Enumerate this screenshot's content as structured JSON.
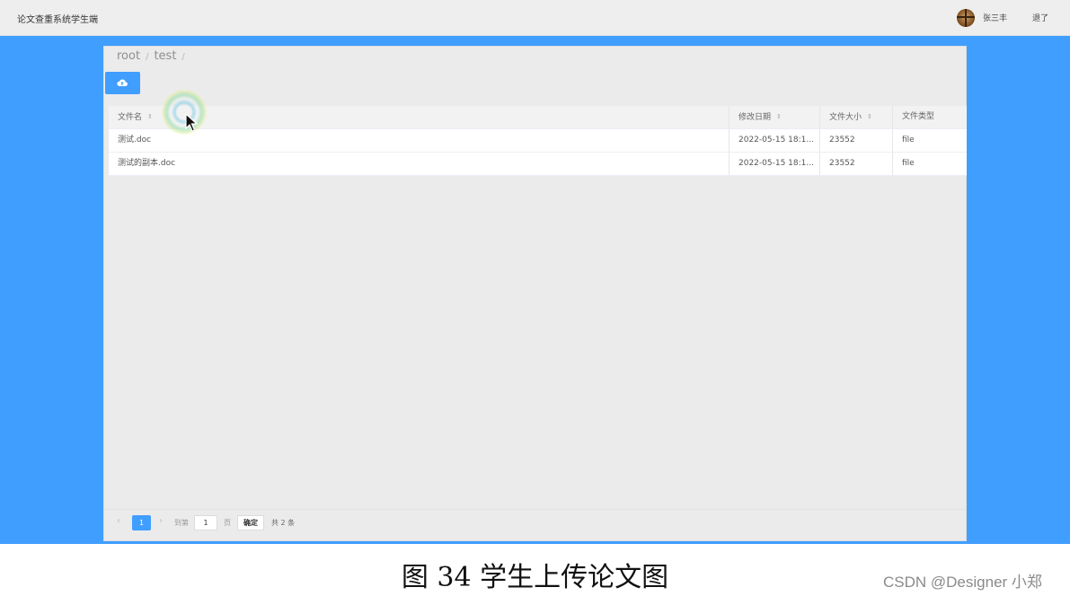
{
  "header": {
    "app_title": "论文查重系统学生端",
    "username": "张三丰",
    "logout_label": "退了"
  },
  "breadcrumb": {
    "items": [
      "root",
      "test"
    ],
    "separator": "/"
  },
  "toolbar": {
    "upload_icon": "cloud-upload-icon"
  },
  "table": {
    "columns": [
      "文件名",
      "修改日期",
      "文件大小",
      "文件类型"
    ],
    "sort_icon": "⇕",
    "rows": [
      {
        "name": "测试.doc",
        "modified": "2022-05-15 18:1...",
        "size": "23552",
        "type": "file"
      },
      {
        "name": "测试的副本.doc",
        "modified": "2022-05-15 18:1...",
        "size": "23552",
        "type": "file"
      }
    ]
  },
  "pagination": {
    "prev": "‹",
    "current_page": "1",
    "next": "›",
    "goto_label": "到第",
    "goto_value": "1",
    "page_label": "页",
    "confirm_label": "确定",
    "total_label": "共 2 条"
  },
  "caption": "图 34 学生上传论文图",
  "watermark": "CSDN @Designer 小郑",
  "colors": {
    "accent": "#409eff",
    "panel_bg": "#ebebeb",
    "header_bg": "#eeeeee"
  }
}
